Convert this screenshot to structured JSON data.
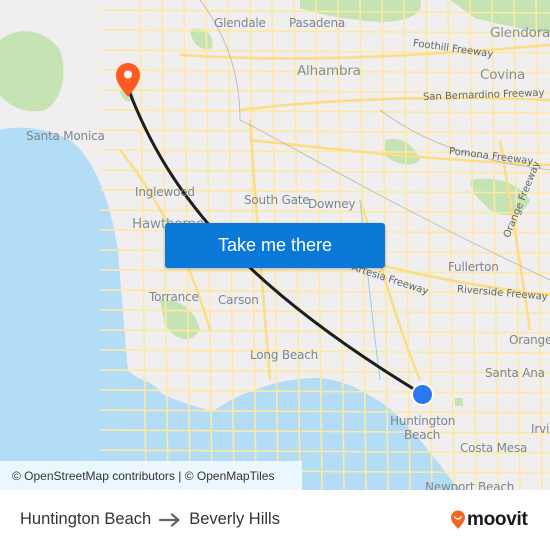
{
  "map": {
    "places": [
      {
        "name": "Glendale",
        "size": "normal"
      },
      {
        "name": "Pasadena",
        "size": "normal"
      },
      {
        "name": "Glendora",
        "size": "big"
      },
      {
        "name": "Alhambra",
        "size": "big"
      },
      {
        "name": "Covina",
        "size": "big"
      },
      {
        "name": "Santa Monica",
        "size": "normal"
      },
      {
        "name": "Inglewood",
        "size": "normal"
      },
      {
        "name": "Hawthorne",
        "size": "big"
      },
      {
        "name": "South Gate",
        "size": "normal"
      },
      {
        "name": "Downey",
        "size": "normal"
      },
      {
        "name": "Fullerton",
        "size": "normal"
      },
      {
        "name": "Torrance",
        "size": "normal"
      },
      {
        "name": "Carson",
        "size": "normal"
      },
      {
        "name": "Long Beach",
        "size": "normal"
      },
      {
        "name": "Orange",
        "size": "normal"
      },
      {
        "name": "Santa Ana",
        "size": "normal"
      },
      {
        "name": "Huntington",
        "size": "normal"
      },
      {
        "name": "Beach",
        "size": "normal"
      },
      {
        "name": "Costa Mesa",
        "size": "normal"
      },
      {
        "name": "Irvi",
        "size": "normal"
      },
      {
        "name": "Newport Beach",
        "size": "normal"
      }
    ],
    "roads": [
      "Foothill Freeway",
      "San Bernardino Freeway",
      "Pomona Freeway",
      "Orange Freeway",
      "Artesia Freeway",
      "Riverside Freeway"
    ],
    "origin_marker": {
      "label": "Huntington Beach",
      "color": "#2a78f0"
    },
    "destination_marker": {
      "label": "Beverly Hills",
      "color": "#ff5a1f"
    },
    "route_color": "#1e1e1e",
    "colors": {
      "land": "#f0eeee",
      "water": "#b3dcf7",
      "park": "#c6e4b3",
      "road": "#fde9a4"
    }
  },
  "cta": {
    "label": "Take me there",
    "color": "#0a78d7"
  },
  "attribution": "© OpenStreetMap contributors | © OpenMapTiles",
  "footer": {
    "origin": "Huntington Beach",
    "destination": "Beverly Hills",
    "brand": "moovit",
    "brand_color": "#f26522"
  }
}
